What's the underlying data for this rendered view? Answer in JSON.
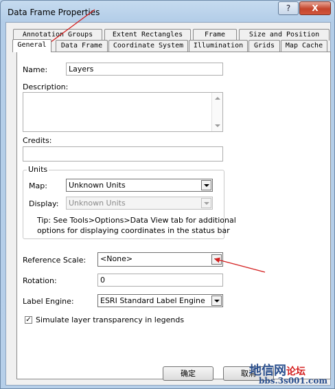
{
  "window": {
    "title": "Data Frame Properties",
    "help_glyph": "?",
    "close_glyph": "X"
  },
  "tabs_back": [
    "Annotation Groups",
    "Extent Rectangles",
    "Frame",
    "Size and Position"
  ],
  "tabs_front": [
    "General",
    "Data Frame",
    "Coordinate System",
    "Illumination",
    "Grids",
    "Map Cache"
  ],
  "general": {
    "name_label": "Name:",
    "name_value": "Layers",
    "description_label": "Description:",
    "credits_label": "Credits:",
    "units_group": "Units",
    "map_label": "Map:",
    "map_value": "Unknown Units",
    "display_label": "Display:",
    "display_value": "Unknown Units",
    "tip_line1": "Tip: See Tools>Options>Data View tab for additional",
    "tip_line2": "options for displaying coordinates in the status bar",
    "reference_scale_label": "Reference Scale:",
    "reference_scale_value": "<None>",
    "rotation_label": "Rotation:",
    "rotation_value": "0",
    "label_engine_label": "Label Engine:",
    "label_engine_value": "ESRI Standard Label Engine",
    "simulate_label": "Simulate layer transparency in legends",
    "simulate_checked": true
  },
  "buttons": {
    "ok": "确定",
    "cancel": "取消"
  },
  "watermark": {
    "cn": "地信网",
    "cn_red": "论坛",
    "url": "bbs.3s001.com"
  },
  "colors": {
    "annotation_arrow": "#d42020"
  }
}
